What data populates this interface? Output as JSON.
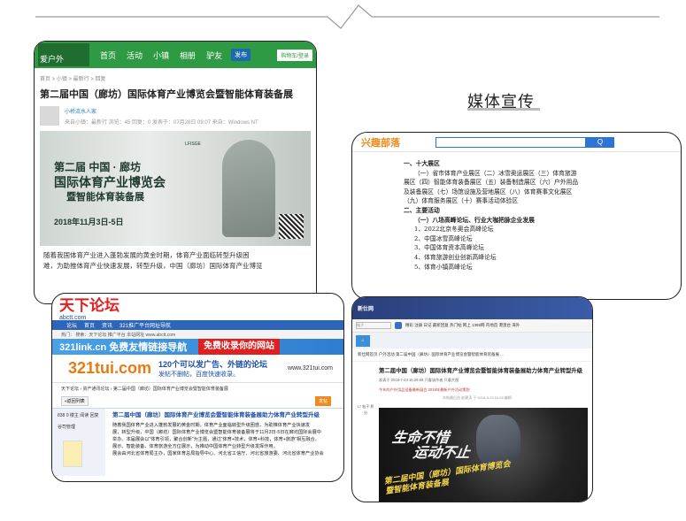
{
  "section_title": "媒体宣传",
  "card1": {
    "site_logo": "爱户外",
    "nav": [
      "首页",
      "活动",
      "小镇",
      "相册",
      "驴友"
    ],
    "nav_button": "发布",
    "login": "购物车/登录",
    "breadcrumb": "首页 > 小镇 > 最新行 > 回复",
    "title": "第二届中国（廊坊）国际体育产业博览会暨智能体育装备展",
    "user": "小桥流水人家",
    "stats": "来自小镇：最新行   浏览：45   回复：0   发表于：07月28日 09:07   来自：Windows NT",
    "poster_line1": "第二届 中国 · 廊坊",
    "poster_line2": "国际体育产业博览会",
    "poster_line3": "暨智能体育装备展",
    "poster_date": "2018年11月3日-5日",
    "poster_logo": "LFISGE",
    "body_line1": "随着我国体育产业进入蓬勃发展的黄金时期，体育产业面临转型升级困",
    "body_line2": "难，为助推体育产业快速发展，转型升级，中国（廊坊）国际体育产业博览"
  },
  "card2": {
    "site_logo": "兴趣部落",
    "search_btn": "Q",
    "lines": [
      {
        "text": "一、十大展区",
        "style": "b"
      },
      {
        "text": "（一）省市体育产业展区（二）冰雪奥运展区（三）体育旅游",
        "style": "i1"
      },
      {
        "text": "展区（四）智能体育装备展区（五）装备制造展区（六）户外用品",
        "style": ""
      },
      {
        "text": "及装备展区（七）场馆设施及营地展区（八）体育赛事文化展区",
        "style": ""
      },
      {
        "text": "（九）体育服务展区（十）赛事活动体验区",
        "style": ""
      },
      {
        "text": "二、主要活动",
        "style": "b"
      },
      {
        "text": "（一）八场高峰论坛、行业大咖把脉企业发展",
        "style": "b i1"
      },
      {
        "text": "1、2022北京冬奥会高峰论坛",
        "style": "i1"
      },
      {
        "text": "2、中国冰雪高峰论坛",
        "style": "i1"
      },
      {
        "text": "3、中国体育资本高峰论坛",
        "style": "i1"
      },
      {
        "text": "4、体育旅游创业创新高峰论坛",
        "style": "i1"
      },
      {
        "text": "5、体育小镇高峰论坛",
        "style": "i1"
      }
    ]
  },
  "card3": {
    "site_logo": "天下论坛",
    "site_url": "abctt.com",
    "nav": [
      "论坛",
      "首页",
      "资讯",
      "321推广平台网址导航"
    ],
    "sub": "热门：  搜索：天下论坛  推广平台 本站网址 www.abctt.com",
    "banner1_left": "321link.cn 免费友情链接导航",
    "banner1_right": "免费收录你的网站",
    "banner2_logo": "321tui.com",
    "banner2_text": "120个可以发广告、外链的论坛",
    "banner2_text2": "发帖不删帖，百度快速收录。",
    "banner2_url": "www.321tui.com",
    "crumb": "天下论坛 › 资产通讯论坛 › 第二届中国（廊坊）国际体育产业博览会暨智能体育装备展",
    "btn_back": "«返回列表",
    "btn_post": "发帖",
    "side_stats": "838   0   楼主   阅读  回复",
    "side_user": "谷司管理",
    "post_title": "第二届中国（廊坊）国际体育产业博览会暨智能体育装备展助力体育产业转型升级",
    "post_body_1": "随着我国体育产业进入蓬勃发展的黄金时期，体育产业面临转型升级困惑，为助推体育产业快速发",
    "post_body_2": "展，转型升级，中国（廊坊）国际体育产业博览会暨智能体育装备展将于11月3日-5日在廊坊国际会展中",
    "post_body_3": "举办。本届展会以“体育引领，聚合创新”为主题，通过“体育+技术，体育+科技，体育+旅游”相互融合，",
    "post_body_4": "展示、智能装备、体育旅游全方位展示，为推动中国体育产业转型升级发挥作用。",
    "post_body_5": "展会由河北省体育局主办，国家体育总局指导中心、河北省工信厅、河北省旅游委、河北省体育产业协会"
  },
  "card4": {
    "site_logo": "新仕网",
    "search_placeholder": "帖子",
    "toolbar_links": "精彩  注册  日记  最新回复 热门帖 网上  1369网  内地首  港澳台  海外",
    "crumb": "新仕网首页  户外活动  第二届中国（廊坊）国际体育产业博览会暨智能体育装备展 ...",
    "title": "第二届中国（廊坊）国际体育产业博览会暨智能体育装备展助力体育产业转型升级",
    "info": "发表于 2018-7-23 15:26:59   只看该作者   只看大图",
    "red": "今年的户外用品设备最新展会 2018年最新户外活动策划",
    "meta": "本帖最后由 赵建涛 于 2018-8-23 16:08 编辑",
    "left_stats": "17 帖子 积分",
    "slogan1": "生命不惜",
    "slogan2": "运动不止",
    "poster_footer1": "第二届中国（廊坊）国际体育博览会",
    "poster_footer2": "暨智能体育装备展"
  }
}
